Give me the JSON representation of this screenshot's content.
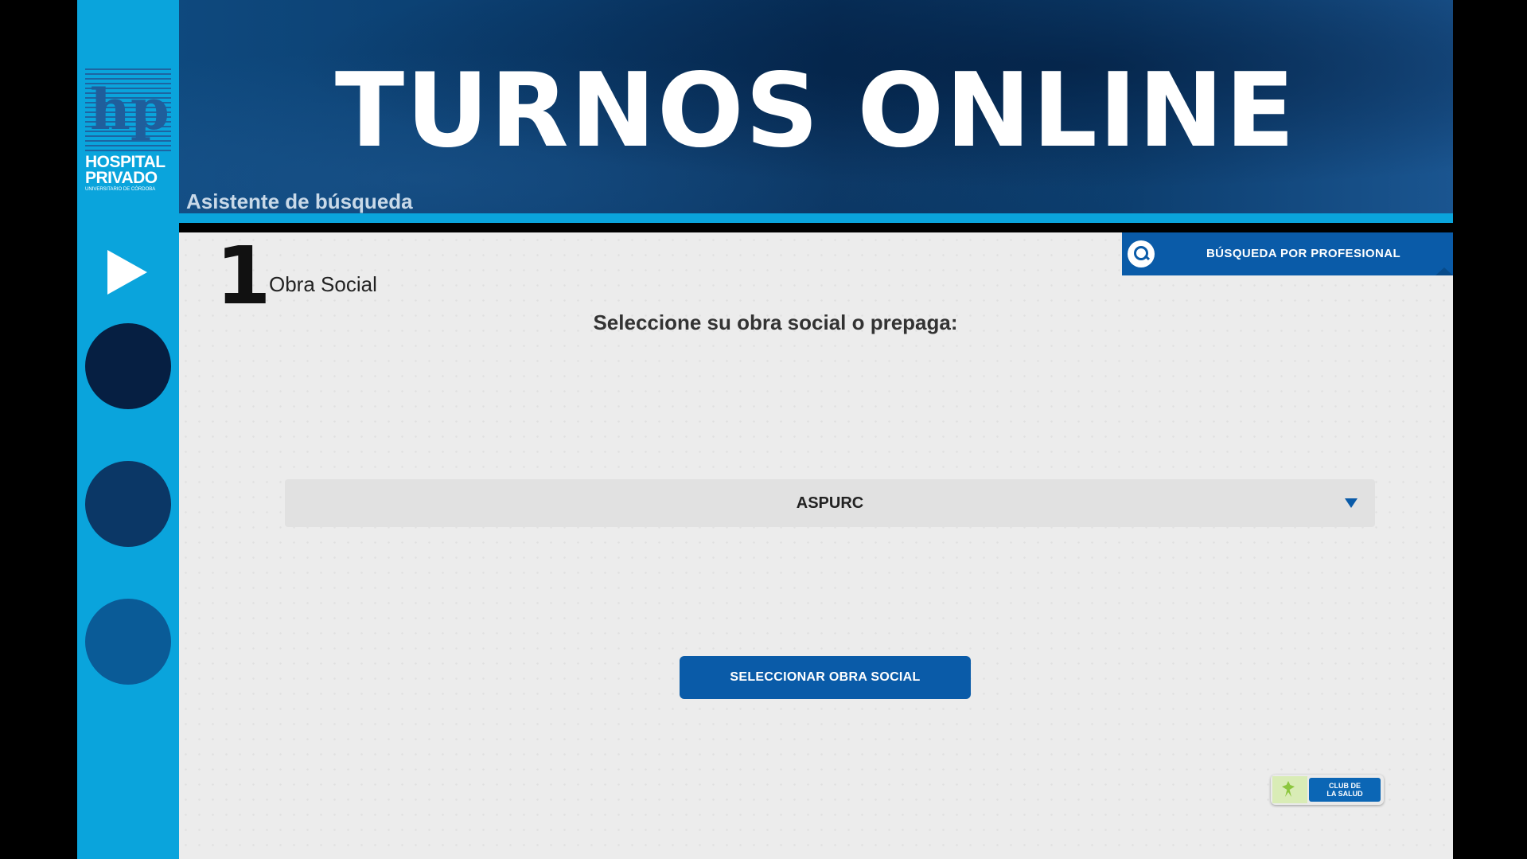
{
  "header": {
    "title": "TURNOS ONLINE",
    "subtitle": "Asistente de búsqueda"
  },
  "logo": {
    "line1": "HOSPITAL",
    "line2": "PRIVADO",
    "line3": "UNIVERSITARIO DE CÓRDOBA",
    "monogram": "hp"
  },
  "sidebar": {
    "steps": [
      {
        "state": "current",
        "icon": "play-icon"
      },
      {
        "state": "pending",
        "color": "#061f42"
      },
      {
        "state": "pending",
        "color": "#0b3766"
      },
      {
        "state": "pending",
        "color": "#0a5b97"
      }
    ]
  },
  "step": {
    "number": "1",
    "label": "Obra Social"
  },
  "main": {
    "prompt": "Seleccione su obra social o prepaga:",
    "select_value": "ASPURC",
    "select_button": "SELECCIONAR OBRA SOCIAL",
    "search_button": "BÚSQUEDA POR PROFESIONAL"
  },
  "badge": {
    "text_line1": "CLUB DE",
    "text_line2": "LA SALUD"
  },
  "colors": {
    "accent": "#0aa4dc",
    "primary": "#0a5ba8",
    "header": "#0b3d6e",
    "background": "#ececec"
  }
}
